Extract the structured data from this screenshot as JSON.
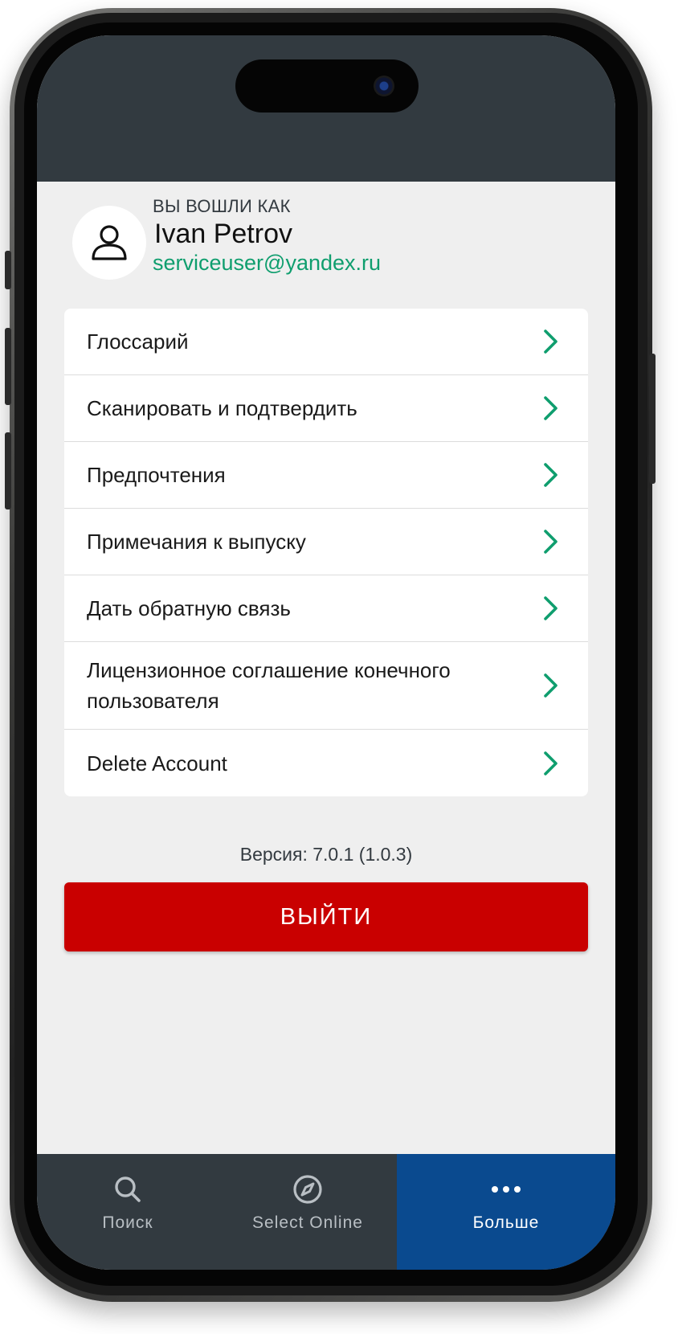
{
  "user": {
    "signed_in_label": "ВЫ ВОШЛИ КАК",
    "name": "Ivan Petrov",
    "email": "serviceuser@yandex.ru"
  },
  "menu": {
    "items": [
      {
        "label": "Глоссарий"
      },
      {
        "label": "Сканировать и подтвердить"
      },
      {
        "label": "Предпочтения"
      },
      {
        "label": "Примечания к выпуску"
      },
      {
        "label": "Дать обратную связь"
      },
      {
        "label": "Лицензионное соглашение конечного пользователя"
      },
      {
        "label": "Delete Account"
      }
    ]
  },
  "version_text": "Версия: 7.0.1 (1.0.3)",
  "logout_label": "ВЫЙТИ",
  "tabbar": {
    "tabs": [
      {
        "label": "Поиск",
        "icon": "search-icon"
      },
      {
        "label": "Select Online",
        "icon": "compass-icon"
      },
      {
        "label": "Больше",
        "icon": "more-icon",
        "active": true
      }
    ]
  },
  "colors": {
    "header_bg": "#323a40",
    "accent_green": "#0f9e6e",
    "logout_red": "#c90000",
    "active_tab": "#0a4a8f",
    "screen_bg": "#efefef"
  }
}
